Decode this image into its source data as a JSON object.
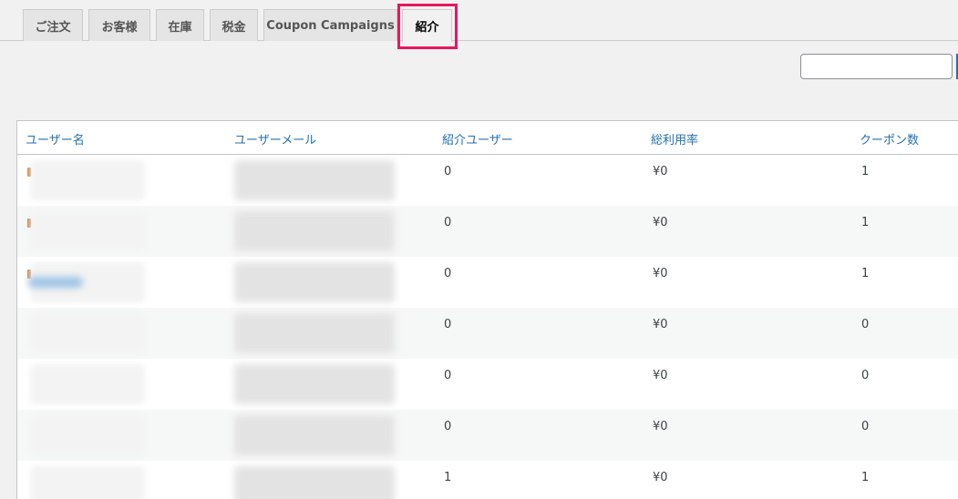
{
  "tabs": [
    {
      "label": "ご注文"
    },
    {
      "label": "お客様"
    },
    {
      "label": "在庫"
    },
    {
      "label": "税金"
    },
    {
      "label": "Coupon Campaigns"
    },
    {
      "label": "紹介",
      "active": true
    }
  ],
  "search": {
    "value": "",
    "placeholder": ""
  },
  "table": {
    "headers": [
      "ユーザー名",
      "ユーザーメール",
      "紹介ユーザー",
      "総利用率",
      "クーポン数"
    ],
    "rows": [
      {
        "referred": "0",
        "total": "¥0",
        "coupons": "1"
      },
      {
        "referred": "0",
        "total": "¥0",
        "coupons": "1"
      },
      {
        "referred": "0",
        "total": "¥0",
        "coupons": "1"
      },
      {
        "referred": "0",
        "total": "¥0",
        "coupons": "0"
      },
      {
        "referred": "0",
        "total": "¥0",
        "coupons": "0"
      },
      {
        "referred": "0",
        "total": "¥0",
        "coupons": "0"
      },
      {
        "referred": "1",
        "total": "¥0",
        "coupons": "1"
      }
    ]
  },
  "colors": {
    "highlight": "#e8175d",
    "link": "#2271b1",
    "name_accent": "#d27b3a"
  },
  "icons": {
    "search_button": "search-button-edge"
  }
}
